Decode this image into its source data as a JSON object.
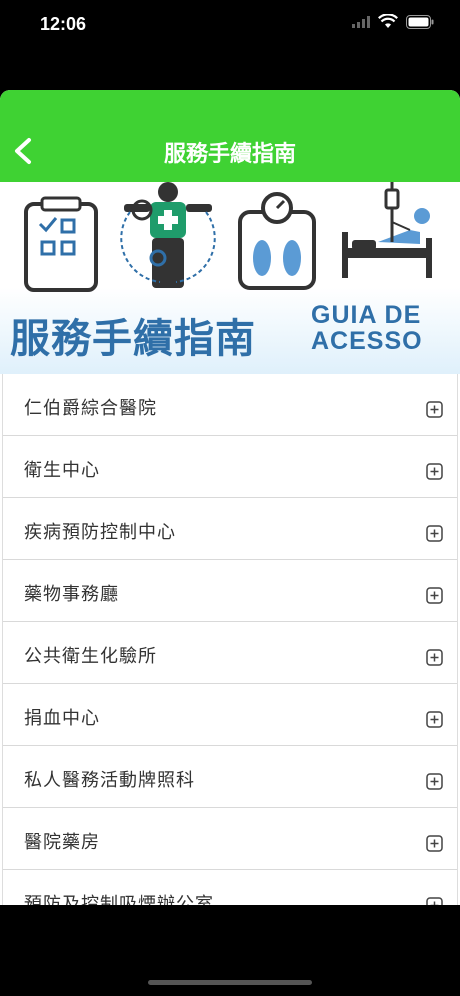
{
  "status_bar": {
    "time": "12:06",
    "icons": [
      "signal-icon",
      "wifi-icon",
      "battery-icon"
    ]
  },
  "nav": {
    "back_icon": "chevron-left-icon",
    "title": "服務手續指南"
  },
  "banner": {
    "title": "服務手續指南",
    "subtitle_line1": "GUIA DE",
    "subtitle_line2": "ACESSO",
    "icons": [
      "checklist-icon",
      "doctor-icon",
      "scale-icon",
      "hospital-bed-icon"
    ]
  },
  "list": {
    "expand_icon": "plus-square-icon",
    "items": [
      {
        "label": "仁伯爵綜合醫院"
      },
      {
        "label": "衛生中心"
      },
      {
        "label": "疾病預防控制中心"
      },
      {
        "label": "藥物事務廳"
      },
      {
        "label": "公共衛生化驗所"
      },
      {
        "label": "捐血中心"
      },
      {
        "label": "私人醫務活動牌照科"
      },
      {
        "label": "醫院藥房"
      },
      {
        "label": "預防及控制吸煙辦公室"
      }
    ]
  },
  "colors": {
    "nav_green": "#3fd233",
    "banner_blue": "#2f6fa8",
    "text": "#333333"
  }
}
